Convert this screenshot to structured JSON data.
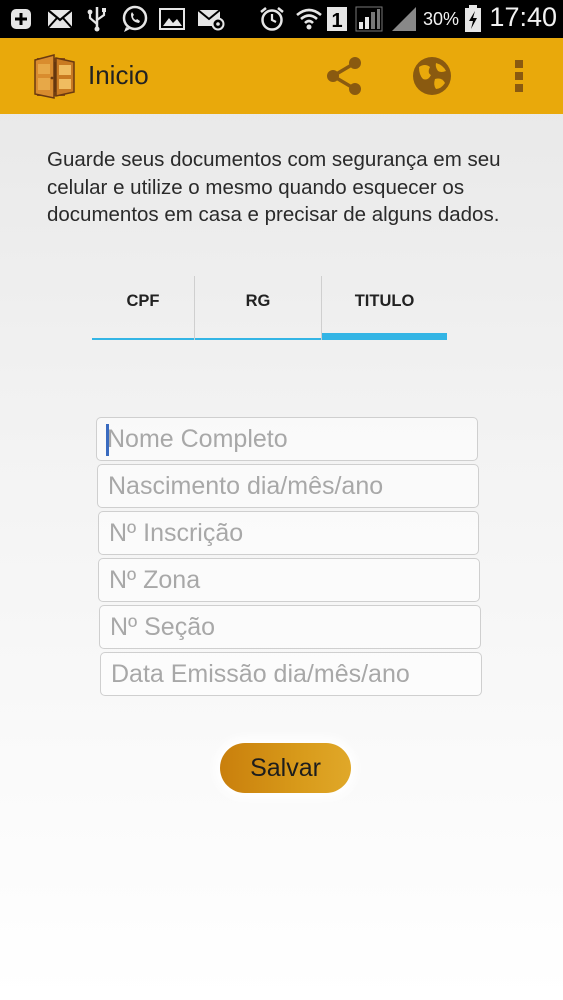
{
  "status_bar": {
    "battery_percent": "30%",
    "time": "17:40",
    "sim_slot": "1",
    "icons": [
      "add-notification-icon",
      "mail-icon",
      "usb-icon",
      "whatsapp-icon",
      "image-icon",
      "email-settings-icon",
      "alarm-icon",
      "wifi-icon",
      "sim-icon",
      "signal-icon",
      "signal-icon-2",
      "battery-charging-icon"
    ]
  },
  "action_bar": {
    "title": "Inicio",
    "logo": "door-logo-icon",
    "actions": [
      "share-icon",
      "globe-icon",
      "overflow-menu-icon"
    ],
    "accent_color": "#e9a90b"
  },
  "intro": {
    "text": "Guarde seus documentos com segurança em seu celular e utilize o mesmo quando esquecer os documentos em casa e precisar de alguns dados."
  },
  "tabs": [
    {
      "label": "CPF",
      "active": false
    },
    {
      "label": "RG",
      "active": false
    },
    {
      "label": "TITULO",
      "active": true
    }
  ],
  "form": {
    "nome_placeholder": "Nome Completo",
    "nascimento_placeholder": "Nascimento dia/mês/ano",
    "inscricao_placeholder": "Nº Inscrição",
    "zona_placeholder": "Nº Zona",
    "secao_placeholder": "Nº Seção",
    "emissao_placeholder": "Data Emissão dia/mês/ano"
  },
  "save_button": {
    "label": "Salvar"
  },
  "colors": {
    "tab_indicator": "#33b5e5",
    "button": "#d89a1a"
  }
}
